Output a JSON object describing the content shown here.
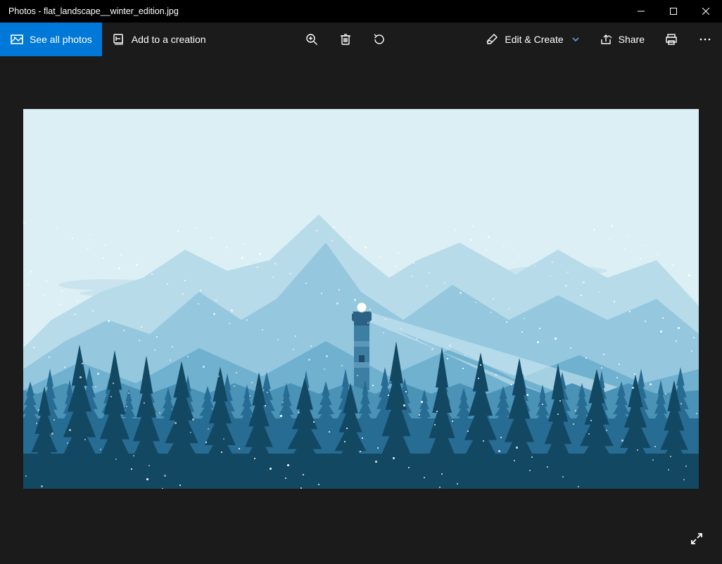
{
  "window": {
    "title": "Photos - flat_landscape__winter_edition.jpg"
  },
  "toolbar": {
    "see_all_label": "See all photos",
    "add_creation_label": "Add to a creation",
    "edit_create_label": "Edit & Create",
    "share_label": "Share"
  }
}
